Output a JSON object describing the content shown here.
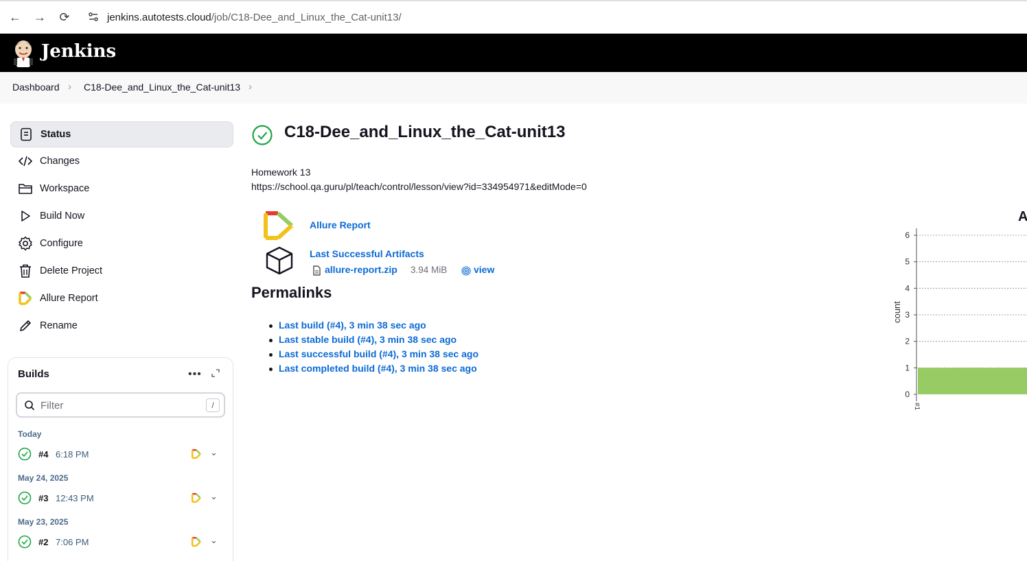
{
  "browser": {
    "url_host": "jenkins.autotests.cloud",
    "url_path": "/job/C18-Dee_and_Linux_the_Cat-unit13/"
  },
  "header": {
    "brand": "Jenkins"
  },
  "breadcrumb": [
    "Dashboard",
    "C18-Dee_and_Linux_the_Cat-unit13"
  ],
  "sidebar": {
    "tasks": [
      {
        "label": "Status",
        "icon": "status-icon"
      },
      {
        "label": "Changes",
        "icon": "code-icon"
      },
      {
        "label": "Workspace",
        "icon": "folder-icon"
      },
      {
        "label": "Build Now",
        "icon": "play-icon"
      },
      {
        "label": "Configure",
        "icon": "gear-icon"
      },
      {
        "label": "Delete Project",
        "icon": "trash-icon"
      },
      {
        "label": "Allure Report",
        "icon": "allure-icon"
      },
      {
        "label": "Rename",
        "icon": "pencil-icon"
      }
    ]
  },
  "builds": {
    "title": "Builds",
    "filter_placeholder": "Filter",
    "filter_shortcut": "/",
    "groups": [
      {
        "date": "Today",
        "number": "#4",
        "time": "6:18 PM"
      },
      {
        "date": "May 24, 2025",
        "number": "#3",
        "time": "12:43 PM"
      },
      {
        "date": "May 23, 2025",
        "number": "#2",
        "time": "7:06 PM"
      }
    ]
  },
  "main": {
    "title": "C18-Dee_and_Linux_the_Cat-unit13",
    "description_line1": "Homework 13",
    "description_line2": "https://school.qa.guru/pl/teach/control/lesson/view?id=334954971&editMode=0",
    "allure_link": "Allure Report",
    "artifacts_link": "Last Successful Artifacts",
    "artifact_file": "allure-report.zip",
    "artifact_size": "3.94 MiB",
    "artifact_view": "view",
    "permalinks_heading": "Permalinks",
    "permalinks": [
      "Last build (#4), 3 min 38 sec ago",
      "Last stable build (#4), 3 min 38 sec ago",
      "Last successful build (#4), 3 min 38 sec ago",
      "Last completed build (#4), 3 min 38 sec ago"
    ]
  },
  "chart_data": {
    "type": "bar",
    "title": "A",
    "ylabel": "count",
    "ylim": [
      0,
      6
    ],
    "yticks": [
      0,
      1,
      2,
      3,
      4,
      5,
      6
    ],
    "categories": [
      "#1"
    ],
    "series": [
      {
        "values": [
          1
        ],
        "color": "#97cc64"
      }
    ],
    "grid": true
  }
}
